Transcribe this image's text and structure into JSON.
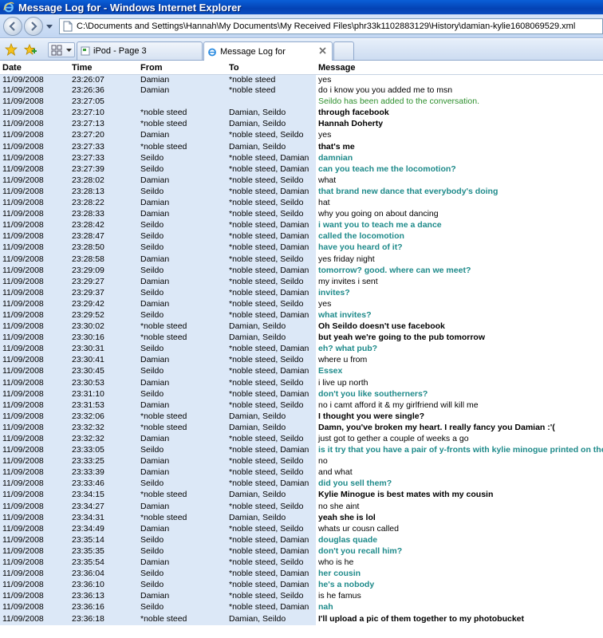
{
  "window": {
    "title": "Message Log for - Windows Internet Explorer"
  },
  "address_bar": {
    "url": "C:\\Documents and Settings\\Hannah\\My Documents\\My Received Files\\phr33k1102883129\\History\\damian-kylie1608069529.xml"
  },
  "tabs": [
    {
      "label": "iPod - Page 3"
    },
    {
      "label": "Message Log for"
    }
  ],
  "log": {
    "headers": [
      "Date",
      "Time",
      "From",
      "To",
      "Message"
    ],
    "rows": [
      [
        "11/09/2008",
        "23:26:07",
        "Damian",
        "*noble steed",
        "yes",
        "damian"
      ],
      [
        "11/09/2008",
        "23:26:36",
        "Damian",
        "*noble steed",
        "do i know you you added me to msn",
        "damian"
      ],
      [
        "11/09/2008",
        "23:27:05",
        "",
        "",
        "Seildo has been added to the conversation.",
        "system"
      ],
      [
        "11/09/2008",
        "23:27:10",
        "*noble steed",
        "Damian, Seildo",
        "through facebook",
        "noble"
      ],
      [
        "11/09/2008",
        "23:27:13",
        "*noble steed",
        "Damian, Seildo",
        "Hannah Doherty",
        "noble"
      ],
      [
        "11/09/2008",
        "23:27:20",
        "Damian",
        "*noble steed, Seildo",
        "yes",
        "damian"
      ],
      [
        "11/09/2008",
        "23:27:33",
        "*noble steed",
        "Damian, Seildo",
        "that's me",
        "noble"
      ],
      [
        "11/09/2008",
        "23:27:33",
        "Seildo",
        "*noble steed, Damian",
        "damnian",
        "seildo"
      ],
      [
        "11/09/2008",
        "23:27:39",
        "Seildo",
        "*noble steed, Damian",
        "can you teach me the locomotion?",
        "seildo"
      ],
      [
        "11/09/2008",
        "23:28:02",
        "Damian",
        "*noble steed, Seildo",
        "what",
        "damian"
      ],
      [
        "11/09/2008",
        "23:28:13",
        "Seildo",
        "*noble steed, Damian",
        "that brand new dance that everybody's doing",
        "seildo"
      ],
      [
        "11/09/2008",
        "23:28:22",
        "Damian",
        "*noble steed, Seildo",
        "hat",
        "damian"
      ],
      [
        "11/09/2008",
        "23:28:33",
        "Damian",
        "*noble steed, Seildo",
        "why you going on about dancing",
        "damian"
      ],
      [
        "11/09/2008",
        "23:28:42",
        "Seildo",
        "*noble steed, Damian",
        "i want you to teach me a dance",
        "seildo"
      ],
      [
        "11/09/2008",
        "23:28:47",
        "Seildo",
        "*noble steed, Damian",
        "called the locomotion",
        "seildo"
      ],
      [
        "11/09/2008",
        "23:28:50",
        "Seildo",
        "*noble steed, Damian",
        "have you heard of it?",
        "seildo"
      ],
      [
        "11/09/2008",
        "23:28:58",
        "Damian",
        "*noble steed, Seildo",
        "yes friday night",
        "damian"
      ],
      [
        "11/09/2008",
        "23:29:09",
        "Seildo",
        "*noble steed, Damian",
        "tomorrow? good. where can we meet?",
        "seildo"
      ],
      [
        "11/09/2008",
        "23:29:27",
        "Damian",
        "*noble steed, Seildo",
        "my invites i sent",
        "damian"
      ],
      [
        "11/09/2008",
        "23:29:37",
        "Seildo",
        "*noble steed, Damian",
        "invites?",
        "seildo"
      ],
      [
        "11/09/2008",
        "23:29:42",
        "Damian",
        "*noble steed, Seildo",
        "yes",
        "damian"
      ],
      [
        "11/09/2008",
        "23:29:52",
        "Seildo",
        "*noble steed, Damian",
        "what invites?",
        "seildo"
      ],
      [
        "11/09/2008",
        "23:30:02",
        "*noble steed",
        "Damian, Seildo",
        "Oh Seildo doesn't use facebook",
        "noble"
      ],
      [
        "11/09/2008",
        "23:30:16",
        "*noble steed",
        "Damian, Seildo",
        "but yeah we're going to the pub tomorrow",
        "noble"
      ],
      [
        "11/09/2008",
        "23:30:31",
        "Seildo",
        "*noble steed, Damian",
        "eh? what pub?",
        "seildo"
      ],
      [
        "11/09/2008",
        "23:30:41",
        "Damian",
        "*noble steed, Seildo",
        "where u from",
        "damian"
      ],
      [
        "11/09/2008",
        "23:30:45",
        "Seildo",
        "*noble steed, Damian",
        "Essex",
        "seildo"
      ],
      [
        "11/09/2008",
        "23:30:53",
        "Damian",
        "*noble steed, Seildo",
        "i live up north",
        "damian"
      ],
      [
        "11/09/2008",
        "23:31:10",
        "Seildo",
        "*noble steed, Damian",
        "don't you like southerners?",
        "seildo"
      ],
      [
        "11/09/2008",
        "23:31:53",
        "Damian",
        "*noble steed, Seildo",
        "no i camt afford it & my girlfriend will kill me",
        "damian"
      ],
      [
        "11/09/2008",
        "23:32:06",
        "*noble steed",
        "Damian, Seildo",
        "I thought you were single?",
        "noble"
      ],
      [
        "11/09/2008",
        "23:32:32",
        "*noble steed",
        "Damian, Seildo",
        "Damn, you've broken my heart. I really fancy you Damian :'(",
        "noble"
      ],
      [
        "11/09/2008",
        "23:32:32",
        "Damian",
        "*noble steed, Seildo",
        "just got to gether a couple of weeks a go",
        "damian"
      ],
      [
        "11/09/2008",
        "23:33:05",
        "Seildo",
        "*noble steed, Damian",
        "is it try that you have a pair of y-fronts with kylie minogue printed on the front and jason donovan on the back?",
        "seildo"
      ],
      [
        "11/09/2008",
        "23:33:25",
        "Damian",
        "*noble steed, Seildo",
        "no",
        "damian"
      ],
      [
        "11/09/2008",
        "23:33:39",
        "Damian",
        "*noble steed, Seildo",
        "and what",
        "damian"
      ],
      [
        "11/09/2008",
        "23:33:46",
        "Seildo",
        "*noble steed, Damian",
        "did you sell them?",
        "seildo"
      ],
      [
        "11/09/2008",
        "23:34:15",
        "*noble steed",
        "Damian, Seildo",
        "Kylie Minogue is best mates with my cousin",
        "noble"
      ],
      [
        "11/09/2008",
        "23:34:27",
        "Damian",
        "*noble steed, Seildo",
        "no she aint",
        "damian"
      ],
      [
        "11/09/2008",
        "23:34:31",
        "*noble steed",
        "Damian, Seildo",
        "yeah she is lol",
        "noble"
      ],
      [
        "11/09/2008",
        "23:34:49",
        "Damian",
        "*noble steed, Seildo",
        "whats ur cousn called",
        "damian"
      ],
      [
        "11/09/2008",
        "23:35:14",
        "Seildo",
        "*noble steed, Damian",
        "douglas quade",
        "seildo"
      ],
      [
        "11/09/2008",
        "23:35:35",
        "Seildo",
        "*noble steed, Damian",
        "don't you recall him?",
        "seildo"
      ],
      [
        "11/09/2008",
        "23:35:54",
        "Damian",
        "*noble steed, Seildo",
        "who is he",
        "damian"
      ],
      [
        "11/09/2008",
        "23:36:04",
        "Seildo",
        "*noble steed, Damian",
        "her cousin",
        "seildo"
      ],
      [
        "11/09/2008",
        "23:36:10",
        "Seildo",
        "*noble steed, Damian",
        "he's a nobody",
        "seildo"
      ],
      [
        "11/09/2008",
        "23:36:13",
        "Damian",
        "*noble steed, Seildo",
        "is he famus",
        "damian"
      ],
      [
        "11/09/2008",
        "23:36:16",
        "Seildo",
        "*noble steed, Damian",
        "nah",
        "seildo"
      ],
      [
        "11/09/2008",
        "23:36:18",
        "*noble steed",
        "Damian, Seildo",
        "I'll upload a pic of them together to my photobucket",
        "noble"
      ]
    ]
  },
  "colors": {
    "titlebar": "#0442b4",
    "meta_cell_bg": "#dce8f7",
    "seildo_text": "#1e8a8a",
    "system_text": "#2d8f2d"
  }
}
